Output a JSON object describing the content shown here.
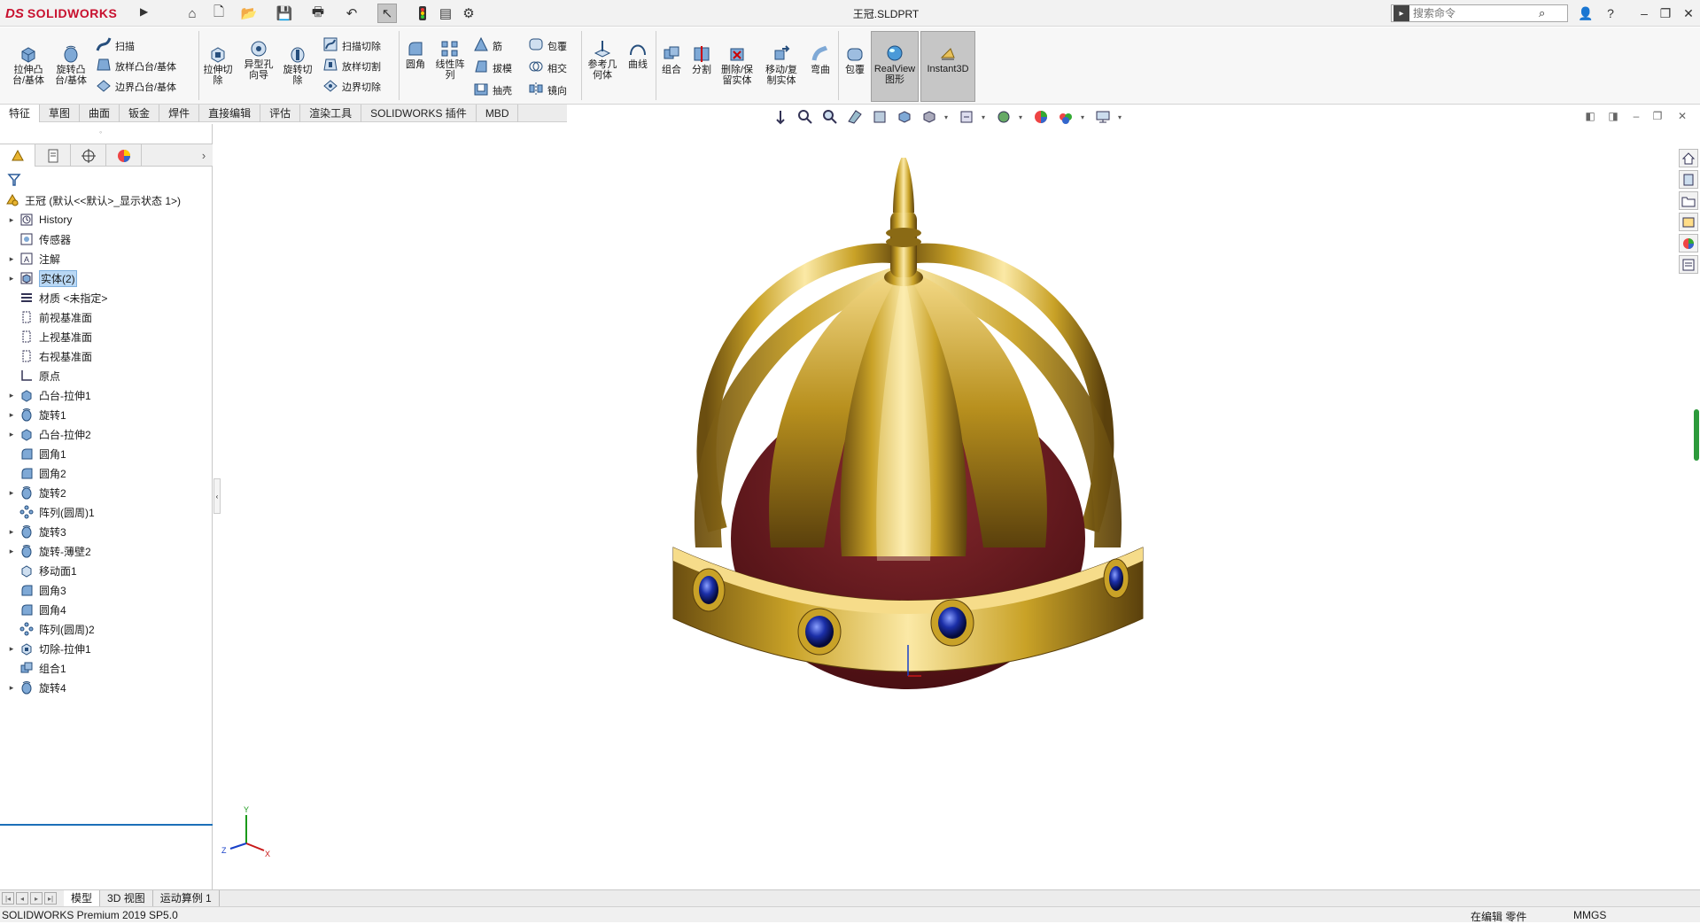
{
  "app": {
    "logo_prefix": "DS",
    "logo_text": "SOLIDWORKS",
    "document_title": "王冠.SLDPRT",
    "search_placeholder": "搜索命令"
  },
  "command_manager": {
    "buttons": [
      {
        "id": "extrude-boss",
        "label": "拉伸凸\n台/基体"
      },
      {
        "id": "revolve-boss",
        "label": "旋转凸\n台/基体"
      },
      {
        "id": "sweep",
        "label": "扫描"
      },
      {
        "id": "loft-boss",
        "label": "放样凸台/基体"
      },
      {
        "id": "boundary-boss",
        "label": "边界凸台/基体"
      },
      {
        "id": "extrude-cut",
        "label": "拉伸切\n除"
      },
      {
        "id": "hole-wizard",
        "label": "异型孔\n向导"
      },
      {
        "id": "revolve-cut",
        "label": "旋转切\n除"
      },
      {
        "id": "sweep-cut",
        "label": "扫描切除"
      },
      {
        "id": "loft-cut",
        "label": "放样切割"
      },
      {
        "id": "boundary-cut",
        "label": "边界切除"
      },
      {
        "id": "fillet",
        "label": "圆角"
      },
      {
        "id": "linear-pattern",
        "label": "线性阵\n列"
      },
      {
        "id": "rib",
        "label": "筋"
      },
      {
        "id": "draft",
        "label": "拔模"
      },
      {
        "id": "shell",
        "label": "抽壳"
      },
      {
        "id": "wrap",
        "label": "包覆"
      },
      {
        "id": "intersect",
        "label": "相交"
      },
      {
        "id": "mirror",
        "label": "镜向"
      },
      {
        "id": "ref-geometry",
        "label": "参考几\n何体"
      },
      {
        "id": "curves",
        "label": "曲线"
      },
      {
        "id": "combine",
        "label": "组合"
      },
      {
        "id": "split",
        "label": "分割"
      },
      {
        "id": "delete-keep-body",
        "label": "删除/保\n留实体"
      },
      {
        "id": "move-copy-body",
        "label": "移动/复\n制实体"
      },
      {
        "id": "flex",
        "label": "弯曲"
      },
      {
        "id": "wrap2",
        "label": "包覆"
      },
      {
        "id": "realview",
        "label": "RealView\n图形"
      },
      {
        "id": "instant3d",
        "label": "Instant3D"
      }
    ],
    "tabs": [
      "特征",
      "草图",
      "曲面",
      "钣金",
      "焊件",
      "直接编辑",
      "评估",
      "渲染工具",
      "SOLIDWORKS 插件",
      "MBD"
    ],
    "active_tab": "特征"
  },
  "feature_tree": {
    "root": "王冠  (默认<<默认>_显示状态 1>)",
    "items": [
      {
        "label": "History",
        "icon": "history-icon",
        "expandable": true
      },
      {
        "label": "传感器",
        "icon": "sensor-icon",
        "expandable": false
      },
      {
        "label": "注解",
        "icon": "annotation-icon",
        "expandable": true
      },
      {
        "label": "实体(2)",
        "icon": "solid-bodies-icon",
        "expandable": true,
        "selected": true
      },
      {
        "label": "材质 <未指定>",
        "icon": "material-icon",
        "expandable": false
      },
      {
        "label": "前视基准面",
        "icon": "plane-icon",
        "expandable": false
      },
      {
        "label": "上视基准面",
        "icon": "plane-icon",
        "expandable": false
      },
      {
        "label": "右视基准面",
        "icon": "plane-icon",
        "expandable": false
      },
      {
        "label": "原点",
        "icon": "origin-icon",
        "expandable": false
      },
      {
        "label": "凸台-拉伸1",
        "icon": "extrude-icon",
        "expandable": true
      },
      {
        "label": "旋转1",
        "icon": "revolve-icon",
        "expandable": true
      },
      {
        "label": "凸台-拉伸2",
        "icon": "extrude-icon",
        "expandable": true
      },
      {
        "label": "圆角1",
        "icon": "fillet-icon",
        "expandable": false
      },
      {
        "label": "圆角2",
        "icon": "fillet-icon",
        "expandable": false
      },
      {
        "label": "旋转2",
        "icon": "revolve-icon",
        "expandable": true
      },
      {
        "label": "阵列(圆周)1",
        "icon": "pattern-icon",
        "expandable": false
      },
      {
        "label": "旋转3",
        "icon": "revolve-icon",
        "expandable": true
      },
      {
        "label": "旋转-薄壁2",
        "icon": "revolve-icon",
        "expandable": true
      },
      {
        "label": "移动面1",
        "icon": "move-face-icon",
        "expandable": false
      },
      {
        "label": "圆角3",
        "icon": "fillet-icon",
        "expandable": false
      },
      {
        "label": "圆角4",
        "icon": "fillet-icon",
        "expandable": false
      },
      {
        "label": "阵列(圆周)2",
        "icon": "pattern-icon",
        "expandable": false
      },
      {
        "label": "切除-拉伸1",
        "icon": "cut-extrude-icon",
        "expandable": true
      },
      {
        "label": "组合1",
        "icon": "combine-icon",
        "expandable": false
      },
      {
        "label": "旋转4",
        "icon": "revolve-icon",
        "expandable": true
      }
    ]
  },
  "bottom_tabs": [
    "模型",
    "3D 视图",
    "运动算例 1"
  ],
  "status": {
    "product": "SOLIDWORKS Premium 2019 SP5.0",
    "editing": "在编辑 零件",
    "units": "MMGS"
  },
  "triad": {
    "x": "X",
    "y": "Y",
    "z": "Z"
  },
  "colors": {
    "accent": "#1c6fb8",
    "gold": "#c9a227",
    "velvet": "#6e1a1f",
    "gem": "#1b2fa8"
  }
}
